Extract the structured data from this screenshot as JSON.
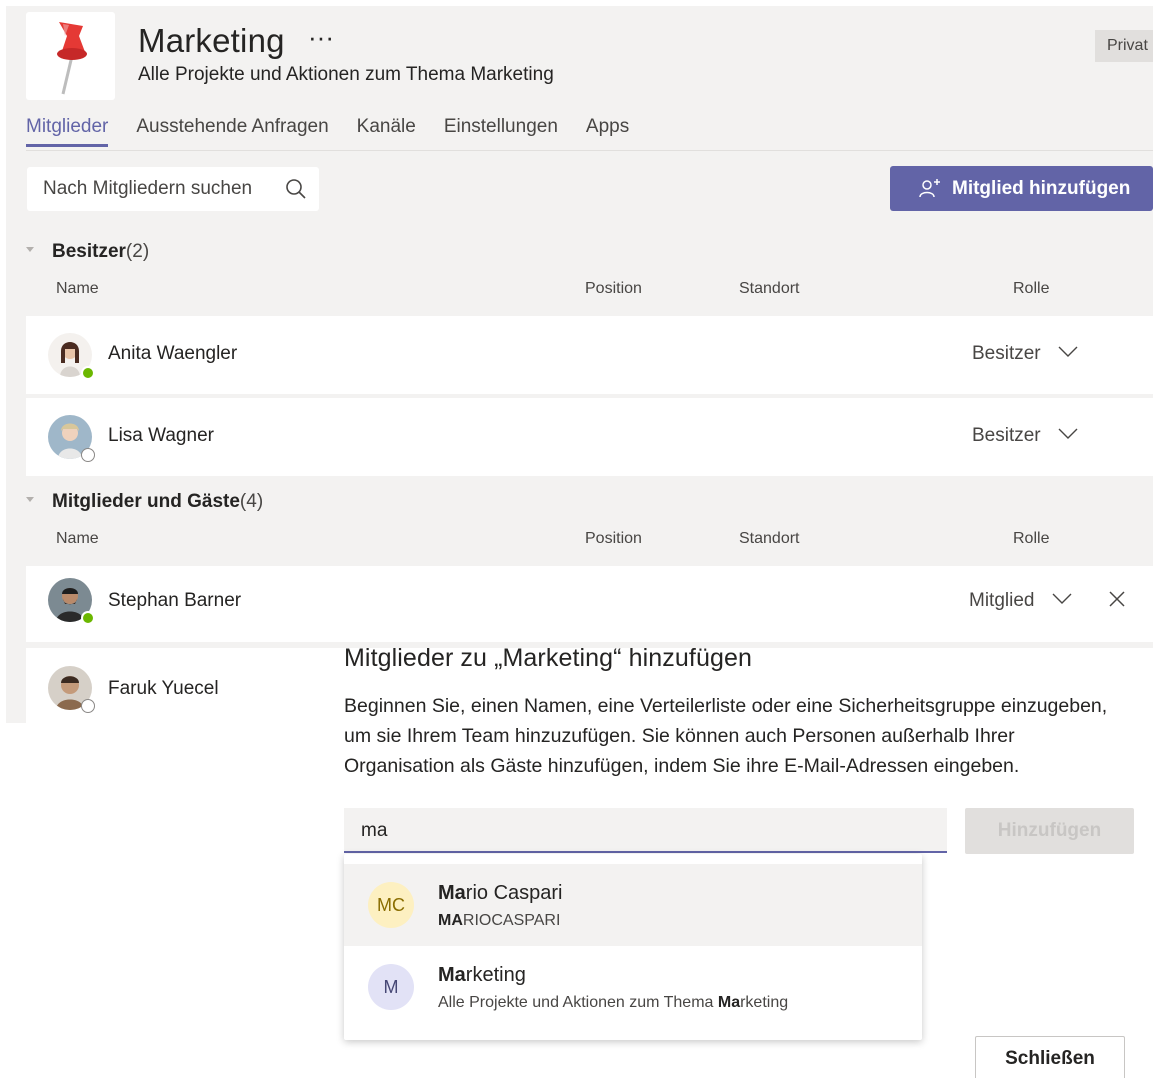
{
  "team": {
    "name": "Marketing",
    "more": "···",
    "description": "Alle Projekte und Aktionen zum Thema Marketing",
    "privacy": "Privat"
  },
  "tabs": [
    "Mitglieder",
    "Ausstehende Anfragen",
    "Kanäle",
    "Einstellungen",
    "Apps"
  ],
  "search": {
    "placeholder": "Nach Mitgliedern suchen"
  },
  "add_member_label": "Mitglied hinzufügen",
  "columns": {
    "name": "Name",
    "position": "Position",
    "location": "Standort",
    "role": "Rolle"
  },
  "owners": {
    "title": "Besitzer",
    "count": "(2)",
    "members": [
      {
        "name": "Anita Waengler",
        "role": "Besitzer",
        "status": "available"
      },
      {
        "name": "Lisa Wagner",
        "role": "Besitzer",
        "status": "offline"
      }
    ]
  },
  "members_guests": {
    "title": "Mitglieder und Gäste",
    "count": "(4)",
    "members": [
      {
        "name": "Stephan Barner",
        "role": "Mitglied",
        "status": "available"
      },
      {
        "name": "Faruk Yuecel",
        "status": "offline"
      }
    ]
  },
  "dialog": {
    "title": "Mitglieder zu „Marketing“ hinzufügen",
    "description": "Beginnen Sie, einen Namen, eine Verteilerliste oder eine Sicherheitsgruppe einzugeben, um sie Ihrem Team hinzuzufügen. Sie können auch Personen außerhalb Ihrer Organisation als Gäste hinzufügen, indem Sie ihre E-Mail-Adressen eingeben.",
    "input_value": "ma",
    "add_button": "Hinzufügen",
    "close_button": "Schließen",
    "suggestions": [
      {
        "initials": "MC",
        "name_match": "Ma",
        "name_rest": "rio Caspari",
        "sub_match": "MA",
        "sub_rest": "RIOCASPARI",
        "color": "#fdf0c1",
        "text_color": "#8a6d00"
      },
      {
        "initials": "M",
        "name_match": "Ma",
        "name_rest": "rketing",
        "sub_pre": "Alle Projekte und Aktionen zum Thema ",
        "sub_match": "Ma",
        "sub_rest": "rketing",
        "color": "#e2e2f6",
        "text_color": "#464775"
      }
    ]
  }
}
